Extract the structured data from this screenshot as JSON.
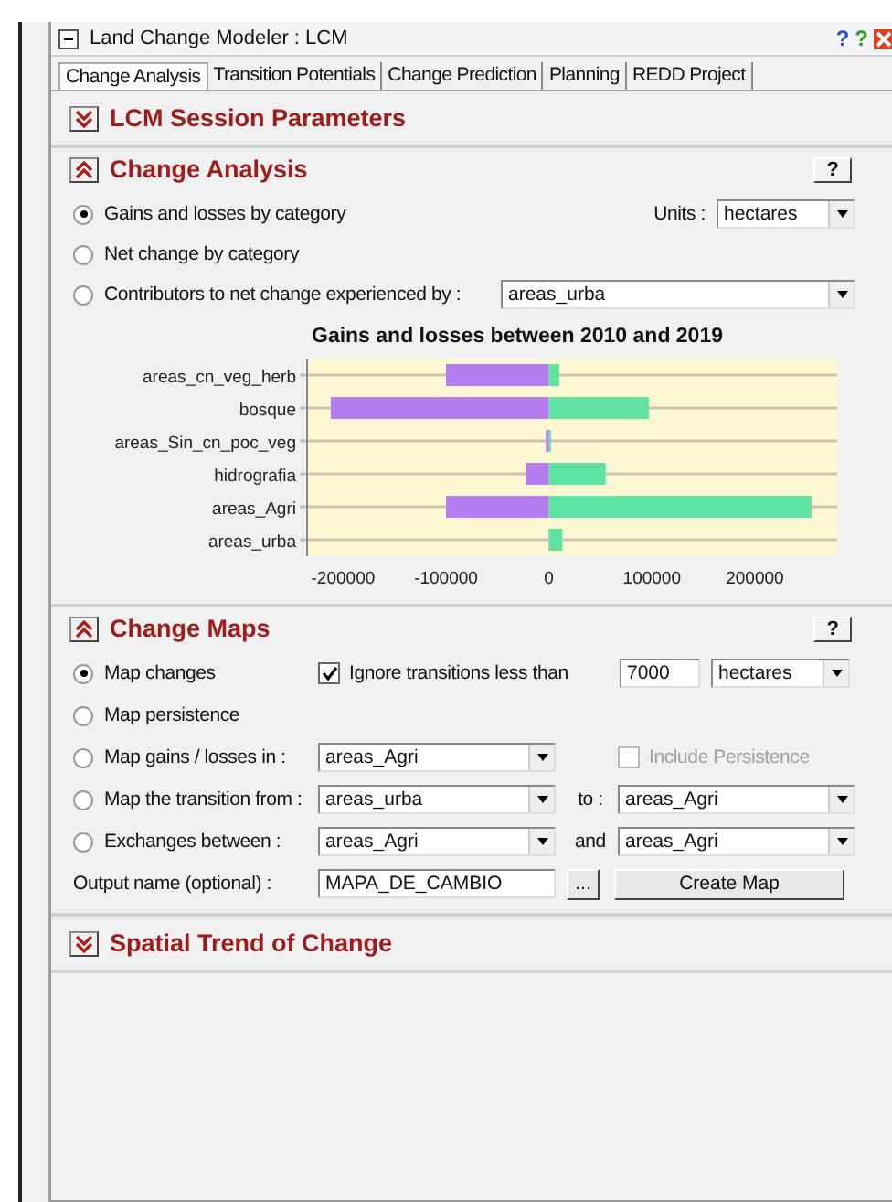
{
  "window": {
    "title": "Land Change Modeler : LCM",
    "help_buttons": [
      "?",
      "?"
    ]
  },
  "tabs": [
    {
      "label": "Change Analysis",
      "selected": true
    },
    {
      "label": "Transition Potentials",
      "selected": false
    },
    {
      "label": "Change Prediction",
      "selected": false
    },
    {
      "label": "Planning",
      "selected": false
    },
    {
      "label": "REDD Project",
      "selected": false
    }
  ],
  "session_parameters": {
    "title": "LCM Session Parameters",
    "expanded": false
  },
  "change_analysis": {
    "title": "Change Analysis",
    "expanded": true,
    "help": "?",
    "options": [
      {
        "label": "Gains and losses by category",
        "selected": true
      },
      {
        "label": "Net change by category",
        "selected": false
      },
      {
        "label": "Contributors to net change experienced by :",
        "selected": false
      }
    ],
    "units_label": "Units :",
    "units_value": "hectares",
    "contributor_value": "areas_urba",
    "chart_data": {
      "type": "bar",
      "title": "Gains and losses between 2010 and 2019",
      "orientation": "horizontal",
      "stacked": true,
      "categories": [
        "areas_cn_veg_herb",
        "bosque",
        "areas_Sin_cn_poc_veg",
        "hidrografia",
        "areas_Agri",
        "areas_urba"
      ],
      "series": [
        {
          "color": "#b57cf0",
          "values": [
            -100000,
            -212000,
            -3000,
            -22000,
            -100000,
            0
          ]
        },
        {
          "color": "#5ee3a3",
          "values": [
            10000,
            97000,
            2000,
            55000,
            255000,
            13000
          ]
        }
      ],
      "xlim": [
        -235000,
        280000
      ],
      "xticks": [
        -200000,
        -100000,
        0,
        100000,
        200000
      ]
    }
  },
  "change_maps": {
    "title": "Change Maps",
    "expanded": true,
    "help": "?",
    "options": [
      {
        "label": "Map changes",
        "selected": true
      },
      {
        "label": "Map persistence",
        "selected": false
      },
      {
        "label": "Map gains / losses in :",
        "selected": false,
        "value": "areas_Agri"
      },
      {
        "label": "Map the transition from :",
        "selected": false,
        "value": "areas_urba",
        "joiner": "to :",
        "value2": "areas_Agri"
      },
      {
        "label": "Exchanges between :",
        "selected": false,
        "value": "areas_Agri",
        "joiner": "and",
        "value2": "areas_Agri"
      }
    ],
    "ignore": {
      "label": "Ignore transitions less than",
      "checked": true,
      "value": "7000",
      "units": "hectares"
    },
    "include_persistence": {
      "label": "Include Persistence",
      "checked": false,
      "disabled": true
    },
    "output_label": "Output name (optional) :",
    "output_value": "MAPA_DE_CAMBIO",
    "browse": "...",
    "create": "Create Map"
  },
  "spatial_trend": {
    "title": "Spatial Trend of Change",
    "expanded": false
  }
}
